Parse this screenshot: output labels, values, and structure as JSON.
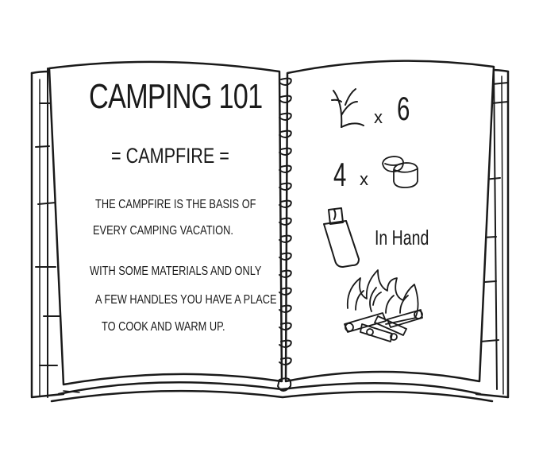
{
  "book": {
    "left_page": {
      "title": "Camping 101",
      "subtitle": "= Campfire =",
      "paragraph1": [
        "The campfire is the basis of",
        "every camping vacation."
      ],
      "paragraph2": [
        "With some materials and only",
        "a few handles you have a place",
        "to cook and warm up."
      ]
    },
    "right_page": {
      "recipe": [
        {
          "icon": "twig-icon",
          "multiplier": "x",
          "quantity": "6"
        },
        {
          "icon": "marshmallow-icon",
          "multiplier": "x",
          "quantity": "4"
        },
        {
          "icon": "lighter-icon",
          "label": "In Hand"
        }
      ],
      "result_icon": "campfire-icon"
    }
  },
  "colors": {
    "ink": "#1a1a1a",
    "paper": "#ffffff"
  }
}
